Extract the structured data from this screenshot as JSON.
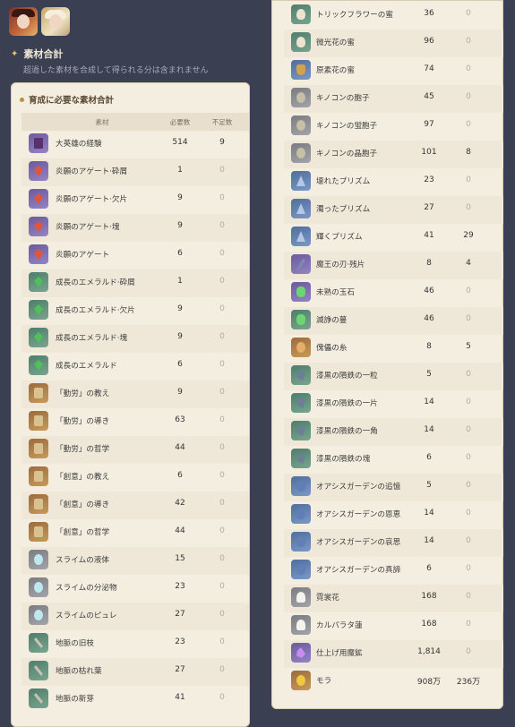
{
  "summary": {
    "title": "素材合計",
    "note": "超過した素材を合成して得られる分は含まれません"
  },
  "left_panel": {
    "title": "育成に必要な素材合計",
    "columns": [
      "素材",
      "必要数",
      "不足数"
    ],
    "rows": [
      {
        "name": "大英雄の経験",
        "required": "514",
        "short": "9",
        "icon": "book-icon"
      },
      {
        "name": "炎願のアゲート·砕屑",
        "required": "1",
        "short": "0",
        "icon": "red-gem-icon"
      },
      {
        "name": "炎願のアゲート·欠片",
        "required": "9",
        "short": "0",
        "icon": "red-gem-icon"
      },
      {
        "name": "炎願のアゲート·塊",
        "required": "9",
        "short": "0",
        "icon": "red-gem-icon"
      },
      {
        "name": "炎願のアゲート",
        "required": "6",
        "short": "0",
        "icon": "red-gem-icon"
      },
      {
        "name": "成長のエメラルド·砕屑",
        "required": "1",
        "short": "0",
        "icon": "green-gem-icon"
      },
      {
        "name": "成長のエメラルド·欠片",
        "required": "9",
        "short": "0",
        "icon": "green-gem-icon"
      },
      {
        "name": "成長のエメラルド·塊",
        "required": "9",
        "short": "0",
        "icon": "green-gem-icon"
      },
      {
        "name": "成長のエメラルド",
        "required": "6",
        "short": "0",
        "icon": "green-gem-icon"
      },
      {
        "name": "「勤労」の教え",
        "required": "9",
        "short": "0",
        "icon": "scroll-icon"
      },
      {
        "name": "「勤労」の導き",
        "required": "63",
        "short": "0",
        "icon": "scroll-icon"
      },
      {
        "name": "「勤労」の哲学",
        "required": "44",
        "short": "0",
        "icon": "scroll-icon"
      },
      {
        "name": "「創意」の教え",
        "required": "6",
        "short": "0",
        "icon": "scroll-icon"
      },
      {
        "name": "「創意」の導き",
        "required": "42",
        "short": "0",
        "icon": "scroll-icon"
      },
      {
        "name": "「創意」の哲学",
        "required": "44",
        "short": "0",
        "icon": "scroll-icon"
      },
      {
        "name": "スライムの液体",
        "required": "15",
        "short": "0",
        "icon": "slime-icon"
      },
      {
        "name": "スライムの分泌物",
        "required": "23",
        "short": "0",
        "icon": "slime-icon"
      },
      {
        "name": "スライムのピュレ",
        "required": "27",
        "short": "0",
        "icon": "slime-icon"
      },
      {
        "name": "地脈の旧枝",
        "required": "23",
        "short": "0",
        "icon": "branch-icon"
      },
      {
        "name": "地脈の枯れ葉",
        "required": "27",
        "short": "0",
        "icon": "branch-icon"
      },
      {
        "name": "地脈の新芽",
        "required": "41",
        "short": "0",
        "icon": "branch-icon"
      }
    ]
  },
  "right_panel": {
    "rows": [
      {
        "name": "トリックフラワーの蜜",
        "required": "36",
        "short": "0",
        "icon": "flower-icon"
      },
      {
        "name": "微光花の蜜",
        "required": "96",
        "short": "0",
        "icon": "flower-icon"
      },
      {
        "name": "原素花の蜜",
        "required": "74",
        "short": "0",
        "icon": "honey-icon"
      },
      {
        "name": "キノコンの胞子",
        "required": "45",
        "short": "0",
        "icon": "spore-icon"
      },
      {
        "name": "キノコンの蛍胞子",
        "required": "97",
        "short": "0",
        "icon": "spore-icon"
      },
      {
        "name": "キノコンの晶胞子",
        "required": "101",
        "short": "8",
        "icon": "spore-icon"
      },
      {
        "name": "壊れたプリズム",
        "required": "23",
        "short": "0",
        "icon": "prism-icon"
      },
      {
        "name": "濁ったプリズム",
        "required": "27",
        "short": "0",
        "icon": "prism-icon"
      },
      {
        "name": "輝くプリズム",
        "required": "41",
        "short": "29",
        "icon": "prism-icon"
      },
      {
        "name": "魔王の刃·残片",
        "required": "8",
        "short": "4",
        "icon": "blade-icon"
      },
      {
        "name": "未熟の玉石",
        "required": "46",
        "short": "0",
        "icon": "jade-icon"
      },
      {
        "name": "滅諍の蔓",
        "required": "46",
        "short": "0",
        "icon": "vine-icon"
      },
      {
        "name": "傀儡の糸",
        "required": "8",
        "short": "5",
        "icon": "thread-icon"
      },
      {
        "name": "漆黒の隕鉄の一粒",
        "required": "5",
        "short": "0",
        "icon": "iron-icon"
      },
      {
        "name": "漆黒の隕鉄の一片",
        "required": "14",
        "short": "0",
        "icon": "iron-icon"
      },
      {
        "name": "漆黒の隕鉄の一角",
        "required": "14",
        "short": "0",
        "icon": "iron-icon"
      },
      {
        "name": "漆黒の隕鉄の塊",
        "required": "6",
        "short": "0",
        "icon": "iron-icon"
      },
      {
        "name": "オアシスガーデンの追憶",
        "required": "5",
        "short": "0",
        "icon": "oasis-icon"
      },
      {
        "name": "オアシスガーデンの恩恵",
        "required": "14",
        "short": "0",
        "icon": "oasis-icon"
      },
      {
        "name": "オアシスガーデンの哀思",
        "required": "14",
        "short": "0",
        "icon": "oasis-icon"
      },
      {
        "name": "オアシスガーデンの真諦",
        "required": "6",
        "short": "0",
        "icon": "oasis-icon"
      },
      {
        "name": "霓裳花",
        "required": "168",
        "short": "0",
        "icon": "lotus-icon"
      },
      {
        "name": "カルパラタ蓮",
        "required": "168",
        "short": "0",
        "icon": "lotus-icon"
      },
      {
        "name": "仕上げ用魔鉱",
        "required": "1,814",
        "short": "0",
        "icon": "ore-icon"
      },
      {
        "name": "モラ",
        "required": "908万",
        "short": "236万",
        "icon": "mora-icon"
      }
    ]
  }
}
